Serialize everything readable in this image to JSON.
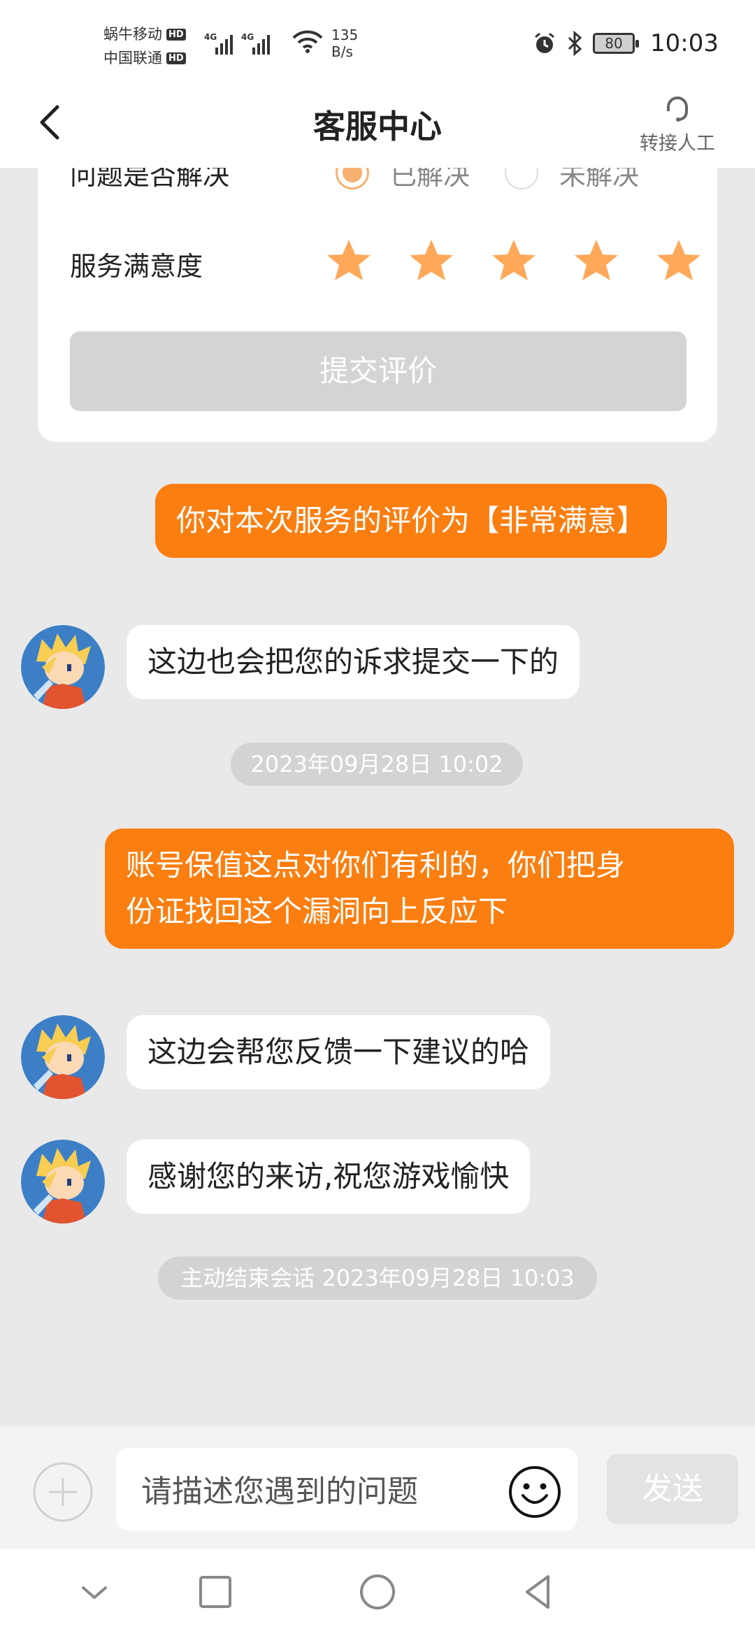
{
  "status_bar": {
    "carrier1": "蜗牛移动",
    "carrier2": "中国联通",
    "hd": "HD",
    "net1": "4G",
    "net2": "4G",
    "speed_value": "135",
    "speed_unit": "B/s",
    "battery": "80",
    "time": "10:03"
  },
  "header": {
    "title": "客服中心",
    "transfer_label": "转接人工"
  },
  "rating_card": {
    "resolved_label": "问题是否解决",
    "option_resolved": "已解决",
    "option_unresolved": "未解决",
    "selected": "已解决",
    "satisfaction_label": "服务满意度",
    "stars_total": 5,
    "stars_selected": 5,
    "star_color": "#fea85a",
    "submit_label": "提交评价"
  },
  "messages": {
    "m1": "你对本次服务的评价为【非常满意】",
    "m2": "这边也会把您的诉求提交一下的",
    "ts1": "2023年09月28日 10:02",
    "m3_line1": "账号保值这点对你们有利的，你们把身",
    "m3_line2": "份证找回这个漏洞向上反应下",
    "m4": "这边会帮您反馈一下建议的哈",
    "m5": "感谢您的来访,祝您游戏愉快",
    "ts2": "主动结束会话 2023年09月28日 10:03"
  },
  "input_bar": {
    "placeholder": "请描述您遇到的问题",
    "send_label": "发送"
  },
  "colors": {
    "accent": "#fb7e10",
    "background": "#e9e9e9"
  }
}
